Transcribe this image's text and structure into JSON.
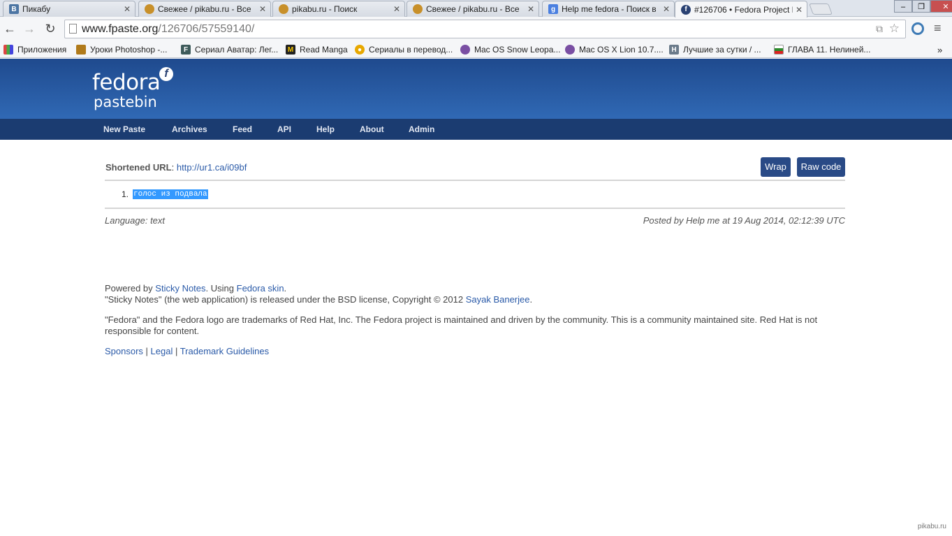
{
  "browser": {
    "tabs": [
      {
        "title": "Пикабу",
        "icon": "vk-icon",
        "color": "#4c75a3"
      },
      {
        "title": "Свежее / pikabu.ru - Все",
        "icon": "pikabu-icon",
        "color": "#c8902a"
      },
      {
        "title": "pikabu.ru - Поиск",
        "icon": "pikabu-icon",
        "color": "#c8902a"
      },
      {
        "title": "Свежее / pikabu.ru - Все",
        "icon": "pikabu-icon",
        "color": "#c8902a"
      },
      {
        "title": "Help me fedora - Поиск в",
        "icon": "google-icon",
        "color": "#4a7fe0"
      },
      {
        "title": "#126706 • Fedora Project P",
        "icon": "fedora-icon",
        "color": "#294172"
      }
    ],
    "url_host": "www.fpaste.org",
    "url_path": "/126706/57559140/",
    "bookmarks": [
      {
        "label": "Приложения",
        "icon": "apps-grid-icon",
        "color": "#d44"
      },
      {
        "label": "Уроки Photoshop -...",
        "icon": "photoshop-icon",
        "color": "#b07a1a"
      },
      {
        "label": "Сериал Аватар: Лег...",
        "icon": "f-icon",
        "color": "#3e5b5b"
      },
      {
        "label": "Read Manga",
        "icon": "manga-icon",
        "color": "#222"
      },
      {
        "label": "Сериалы в перевод...",
        "icon": "circle-icon",
        "color": "#e8a800"
      },
      {
        "label": "Mac OS Snow Leopa...",
        "icon": "dots-icon",
        "color": "#7a4fa3"
      },
      {
        "label": "Mac OS X Lion 10.7....",
        "icon": "dots-icon",
        "color": "#7a4fa3"
      },
      {
        "label": "Лучшие за сутки / ...",
        "icon": "h-icon",
        "color": "#6a7a8a"
      },
      {
        "label": "ГЛАВА 11. Нелиней...",
        "icon": "flag-icon",
        "color": "#2a8a2a"
      }
    ]
  },
  "site": {
    "logo_line1": "fedora",
    "logo_line2": "pastebin",
    "logo_mark": "f",
    "nav": [
      "New Paste",
      "Archives",
      "Feed",
      "API",
      "Help",
      "About",
      "Admin"
    ],
    "accent": "#294a86"
  },
  "paste": {
    "shortened_label": "Shortened URL",
    "shortened_url": "http://ur1.ca/i09bf",
    "wrap_label": "Wrap",
    "raw_label": "Raw code",
    "line_number": "1.",
    "line_text": "голос из подвала",
    "language": "Language: text",
    "posted": "Posted by Help me at 19 Aug 2014, 02:12:39 UTC"
  },
  "footer": {
    "powered_prefix": "Powered by",
    "sticky_notes": "Sticky Notes",
    "using": ". Using",
    "fedora_skin": "Fedora skin",
    "line2_prefix": "\"Sticky Notes\" (the web application) is released under the BSD license, Copyright © 2012",
    "author": "Sayak Banerjee",
    "trademark": "\"Fedora\" and the Fedora logo are trademarks of Red Hat, Inc. The Fedora project is maintained and driven by the community. This is a community maintained site. Red Hat is not responsible for content.",
    "sponsors": "Sponsors",
    "legal": "Legal",
    "trademark_guidelines": "Trademark Guidelines"
  },
  "watermark": "pikabu.ru"
}
